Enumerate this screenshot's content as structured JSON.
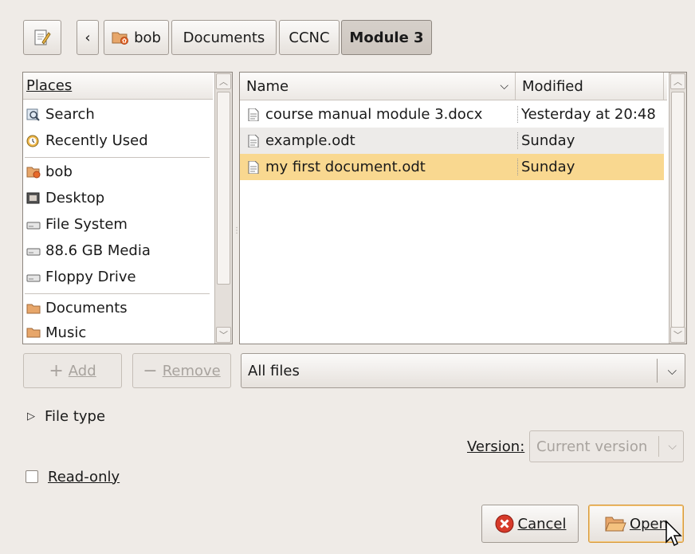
{
  "path_bar": {
    "back": "‹",
    "crumbs": [
      "bob",
      "Documents",
      "CCNC",
      "Module 3"
    ]
  },
  "places": {
    "header": "Places",
    "groups": [
      [
        {
          "label": "Search",
          "icon": "search-icon"
        },
        {
          "label": "Recently Used",
          "icon": "recent-icon"
        }
      ],
      [
        {
          "label": "bob",
          "icon": "home-folder-icon"
        },
        {
          "label": "Desktop",
          "icon": "desktop-icon"
        },
        {
          "label": "File System",
          "icon": "drive-icon"
        },
        {
          "label": "88.6 GB Media",
          "icon": "drive-icon"
        },
        {
          "label": "Floppy Drive",
          "icon": "drive-icon"
        }
      ],
      [
        {
          "label": "Documents",
          "icon": "folder-icon"
        },
        {
          "label": "Music",
          "icon": "folder-icon"
        }
      ]
    ]
  },
  "files": {
    "col_name": "Name",
    "col_modified": "Modified",
    "rows": [
      {
        "name": "course manual module 3.docx",
        "modified": "Yesterday at 20:48",
        "selected": false
      },
      {
        "name": "example.odt",
        "modified": "Sunday",
        "selected": false
      },
      {
        "name": "my first document.odt",
        "modified": "Sunday",
        "selected": true
      }
    ]
  },
  "buttons": {
    "add": "Add",
    "remove": "Remove",
    "cancel": "Cancel",
    "open": "Open"
  },
  "filter": {
    "selected": "All files"
  },
  "file_type": {
    "label": "File type"
  },
  "version": {
    "label": "Version:",
    "value": "Current version"
  },
  "read_only": {
    "label": "Read-only",
    "checked": false
  },
  "colors": {
    "selection": "#f9d890",
    "accent": "#f0b84a"
  }
}
